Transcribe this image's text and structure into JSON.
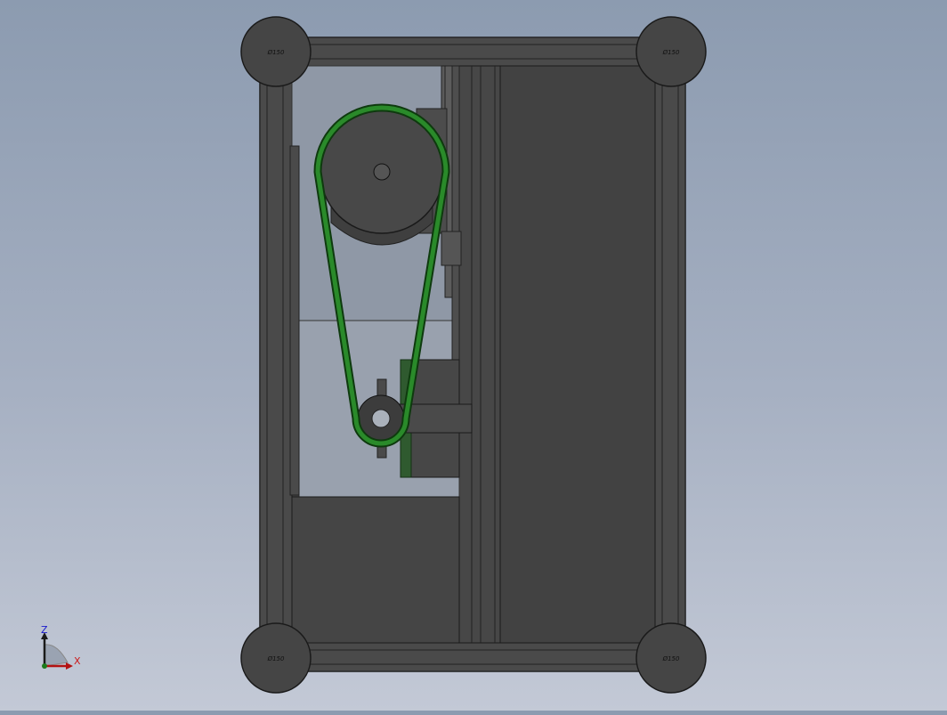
{
  "viewport": {
    "description_label": "",
    "background_top": "#8c9bb0",
    "background_bottom": "#c3c9d6"
  },
  "model": {
    "frame_color": "#454545",
    "belt_color": "#1f7a1f",
    "panel_color": "#8f98a6",
    "foot_text": "Ø150"
  },
  "triad": {
    "z_label": "Z",
    "x_label": "X",
    "z_color": "#1a1acc",
    "x_color": "#cc1a1a"
  }
}
